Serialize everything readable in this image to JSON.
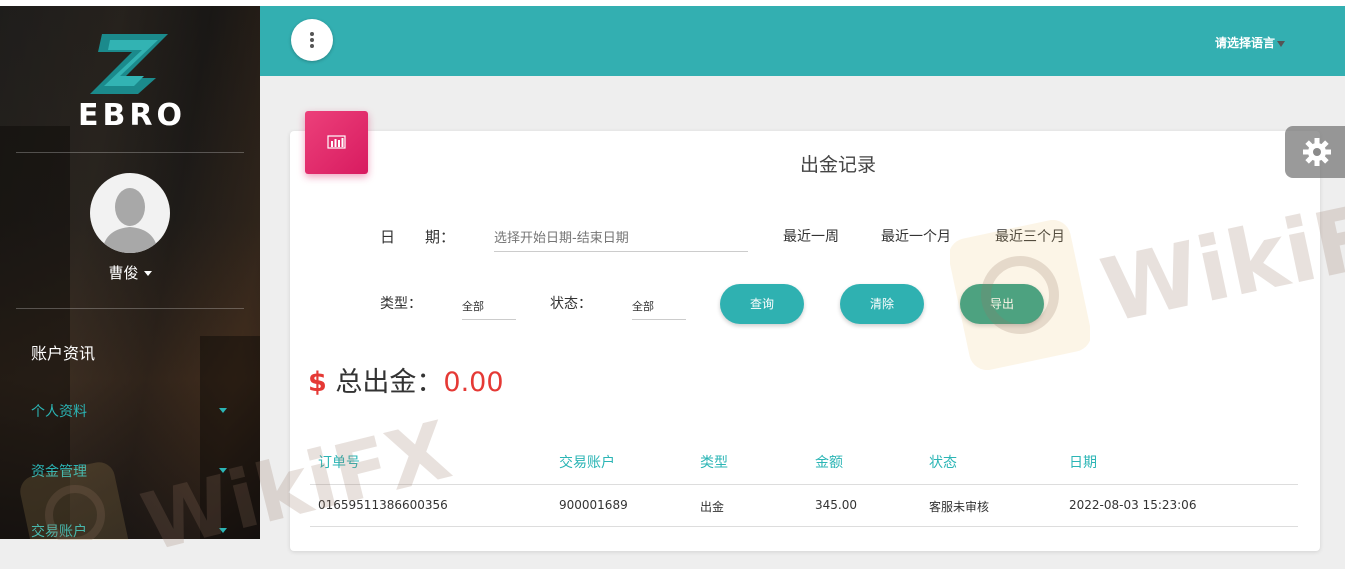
{
  "brand": {
    "logo_text": "EBRO"
  },
  "user": {
    "name": "曹俊"
  },
  "sidebar": {
    "section_title": "账户资讯",
    "items": [
      {
        "label": "个人资料"
      },
      {
        "label": "资金管理"
      },
      {
        "label": "交易账户"
      }
    ]
  },
  "header": {
    "language_select": "请选择语言"
  },
  "page": {
    "title": "出金记录"
  },
  "filters": {
    "date_label": "日　　期：",
    "date_placeholder": "选择开始日期-结束日期",
    "quick_ranges": [
      "最近一周",
      "最近一个月",
      "最近三个月"
    ],
    "type_label": "类型：",
    "type_value": "全部",
    "status_label": "状态：",
    "status_value": "全部"
  },
  "buttons": {
    "query": "查询",
    "clear": "清除",
    "export": "导出"
  },
  "summary": {
    "currency_symbol": "$",
    "label": "总出金：",
    "amount": "0.00"
  },
  "table": {
    "headers": [
      "订单号",
      "交易账户",
      "类型",
      "金额",
      "状态",
      "日期"
    ],
    "rows": [
      [
        "01659511386600356",
        "900001689",
        "出金",
        "345.00",
        "客服未审核",
        "2022-08-03 15:23:06"
      ]
    ]
  },
  "watermark": {
    "text": "WikiFX"
  },
  "colors": {
    "header_teal": "#33afb1",
    "accent_teal": "#2bb5b5",
    "card_icon_pink": "#e91e63",
    "total_red": "#e53935"
  }
}
